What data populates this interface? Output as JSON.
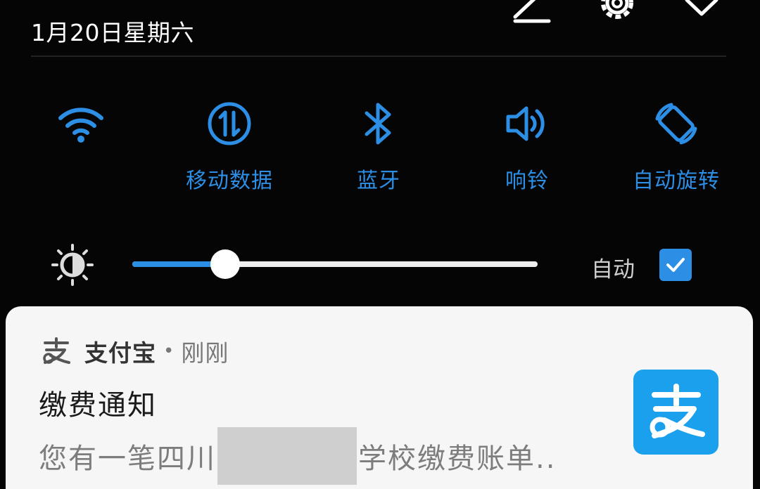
{
  "header": {
    "date": "1月20日星期六",
    "icons": [
      "edit-icon",
      "settings-icon",
      "collapse-icon"
    ]
  },
  "toggles": [
    {
      "name": "wifi",
      "label": "",
      "icon": "wifi-icon"
    },
    {
      "name": "mobile-data",
      "label": "移动数据",
      "icon": "mobile-data-icon"
    },
    {
      "name": "bluetooth",
      "label": "蓝牙",
      "icon": "bluetooth-icon"
    },
    {
      "name": "ring",
      "label": "响铃",
      "icon": "volume-icon"
    },
    {
      "name": "auto-rotate",
      "label": "自动旋转",
      "icon": "rotate-icon"
    }
  ],
  "brightness": {
    "level_percent": 23,
    "auto_label": "自动",
    "auto_checked": true
  },
  "notification": {
    "app_name": "支付宝",
    "separator": "•",
    "time": "刚刚",
    "title": "缴费通知",
    "body_prefix": "您有一笔四川",
    "body_suffix": "学校缴费账单..",
    "logo_icon": "alipay-logo-icon"
  },
  "colors": {
    "accent": "#2d8ee6",
    "background": "#050505",
    "card": "#f6f6f6",
    "alipay_blue": "#1ba0ee"
  }
}
